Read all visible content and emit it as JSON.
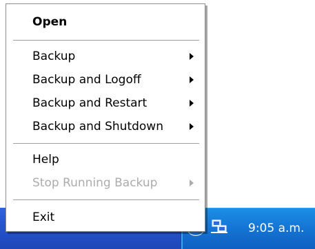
{
  "menu": {
    "open": "Open",
    "backup": "Backup",
    "backup_logoff": "Backup and Logoff",
    "backup_restart": "Backup and Restart",
    "backup_shutdown": "Backup and Shutdown",
    "help": "Help",
    "stop_running_backup": "Stop Running Backup",
    "exit": "Exit"
  },
  "taskbar": {
    "clock": "9:05 a.m.",
    "icons": [
      "chevron-icon",
      "network-icon"
    ]
  },
  "colors": {
    "taskbar_blue": "#2556d0",
    "tray_blue": "#1577d6",
    "disabled_text": "#acacac"
  }
}
